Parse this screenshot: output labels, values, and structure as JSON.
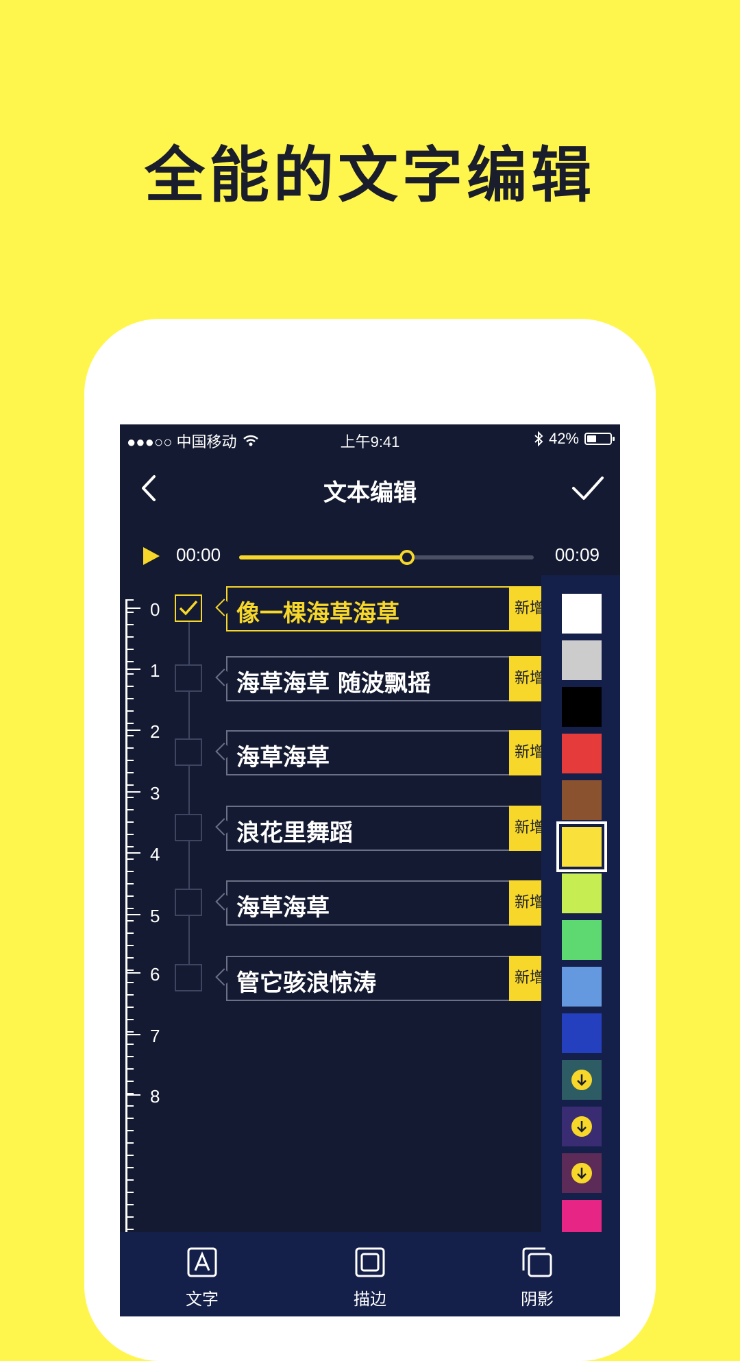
{
  "headline": "全能的文字编辑",
  "status_bar": {
    "carrier": "●●●○○ 中国移动",
    "time": "上午9:41",
    "battery": "42%",
    "battery_level": 0.42
  },
  "nav": {
    "title": "文本编辑",
    "back_icon": "chevron-left-icon",
    "done_icon": "checkmark-icon"
  },
  "player": {
    "current_time": "00:00",
    "total_time": "00:09",
    "progress": 0.57
  },
  "ruler": {
    "labels": [
      "0",
      "1",
      "2",
      "3",
      "4",
      "5",
      "6",
      "7",
      "8"
    ]
  },
  "subtitles": [
    {
      "text": "像一棵海草海草",
      "add_label": "新增",
      "checked": true
    },
    {
      "text": "海草海草 随波飘摇",
      "add_label": "新增",
      "checked": false
    },
    {
      "text": "海草海草",
      "add_label": "新增",
      "checked": false
    },
    {
      "text": "浪花里舞蹈",
      "add_label": "新增",
      "checked": false
    },
    {
      "text": "海草海草",
      "add_label": "新增",
      "checked": false
    },
    {
      "text": "管它骇浪惊涛",
      "add_label": "新增",
      "checked": false
    }
  ],
  "colors": [
    {
      "hex": "#FFFFFF"
    },
    {
      "hex": "#CCCCCC"
    },
    {
      "hex": "#000000"
    },
    {
      "hex": "#E53B3B"
    },
    {
      "hex": "#8B5230"
    },
    {
      "hex": "#F9E03A",
      "selected": true
    },
    {
      "hex": "#C6EE52"
    },
    {
      "hex": "#5ED870"
    },
    {
      "hex": "#6599DF"
    },
    {
      "hex": "#2440BE"
    },
    {
      "hex": "#2D5C64",
      "download": true
    },
    {
      "hex": "#3A2C72",
      "download": true
    },
    {
      "hex": "#5D2B58",
      "download": true
    },
    {
      "hex": "#E62585"
    }
  ],
  "tabs": [
    {
      "label": "文字",
      "icon": "text-frame-icon"
    },
    {
      "label": "描边",
      "icon": "stroke-frame-icon"
    },
    {
      "label": "阴影",
      "icon": "shadow-frame-icon"
    }
  ]
}
